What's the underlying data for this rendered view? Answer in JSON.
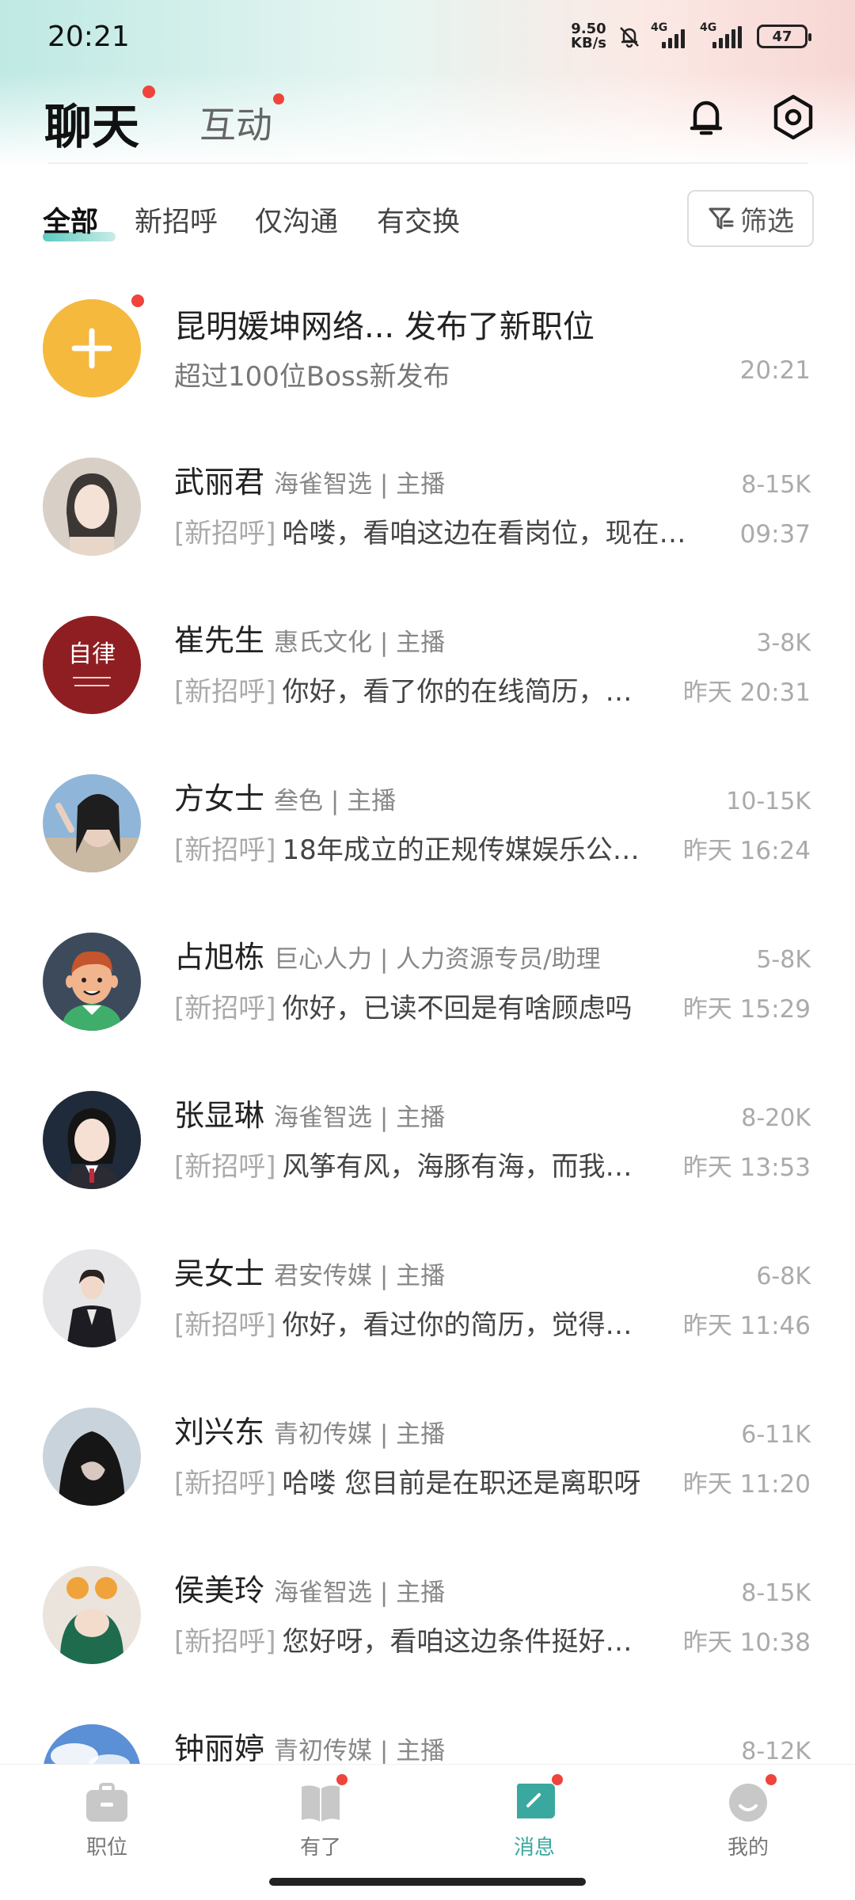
{
  "status_bar": {
    "time": "20:21",
    "net_speed_value": "9.50",
    "net_speed_unit": "KB/s",
    "signal_1": "4G",
    "signal_2": "4G",
    "battery": "47"
  },
  "header": {
    "title_active": "聊天",
    "title_inactive": "互动"
  },
  "filters": {
    "tabs": [
      "全部",
      "新招呼",
      "仅沟通",
      "有交换"
    ],
    "filter_label": "筛选"
  },
  "system_item": {
    "title": "昆明媛坤网络... 发布了新职位",
    "subtitle": "超过100位Boss新发布",
    "time": "20:21",
    "icon": "plus-icon"
  },
  "chats": [
    {
      "name": "武丽君",
      "company": "海雀智选 | 主播",
      "salary": "8-15K",
      "tag": "[新招呼]",
      "message": "哈喽，看咱这边在看岗位，现在…",
      "time": "09:37"
    },
    {
      "name": "崔先生",
      "company": "惠氏文化 | 主播",
      "salary": "3-8K",
      "tag": "[新招呼]",
      "message": "你好，看了你的在线简历，…",
      "time": "昨天 20:31",
      "avatar_text": "自律"
    },
    {
      "name": "方女士",
      "company": "叁色 | 主播",
      "salary": "10-15K",
      "tag": "[新招呼]",
      "message": "18年成立的正规传媒娱乐公…",
      "time": "昨天 16:24"
    },
    {
      "name": "占旭栋",
      "company": "巨心人力 | 人力资源专员/助理",
      "salary": "5-8K",
      "tag": "[新招呼]",
      "message": "你好，已读不回是有啥顾虑吗",
      "time": "昨天 15:29"
    },
    {
      "name": "张显琳",
      "company": "海雀智选 | 主播",
      "salary": "8-20K",
      "tag": "[新招呼]",
      "message": "风筝有风，海豚有海，而我…",
      "time": "昨天 13:53"
    },
    {
      "name": "吴女士",
      "company": "君安传媒 | 主播",
      "salary": "6-8K",
      "tag": "[新招呼]",
      "message": "你好，看过你的简历，觉得…",
      "time": "昨天 11:46"
    },
    {
      "name": "刘兴东",
      "company": "青初传媒 | 主播",
      "salary": "6-11K",
      "tag": "[新招呼]",
      "message": "哈喽 您目前是在职还是离职呀",
      "time": "昨天 11:20"
    },
    {
      "name": "侯美玲",
      "company": "海雀智选 | 主播",
      "salary": "8-15K",
      "tag": "[新招呼]",
      "message": "您好呀，看咱这边条件挺好…",
      "time": "昨天 10:38"
    },
    {
      "name": "钟丽婷",
      "company": "青初传媒 | 主播",
      "salary": "8-12K",
      "tag": "",
      "message": "",
      "time": ""
    }
  ],
  "bottom_nav": [
    {
      "label": "职位",
      "icon": "briefcase-icon"
    },
    {
      "label": "有了",
      "icon": "book-icon"
    },
    {
      "label": "消息",
      "icon": "message-icon"
    },
    {
      "label": "我的",
      "icon": "profile-icon"
    }
  ],
  "colors": {
    "accent": "#3aa89e",
    "red_dot": "#f0433b",
    "system_icon_bg": "#f5b93e"
  }
}
